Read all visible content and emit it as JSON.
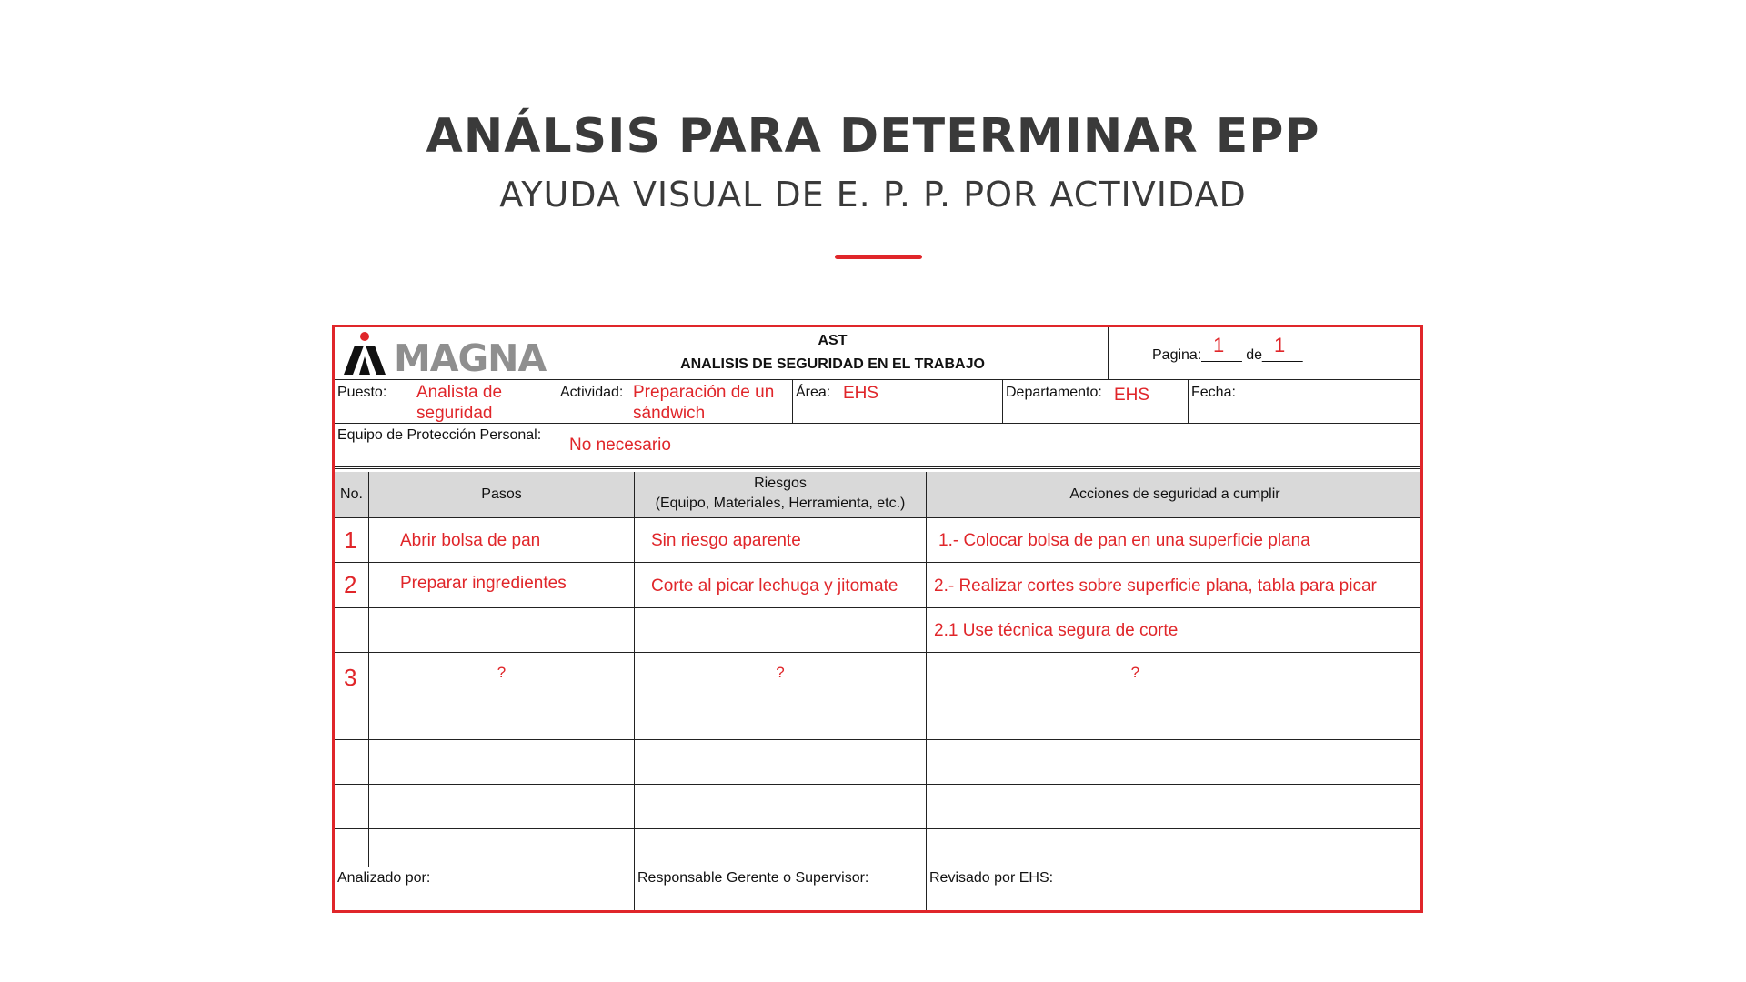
{
  "slide": {
    "title": "ANÁLSIS PARA DETERMINAR EPP",
    "subtitle": "AYUDA VISUAL DE E. P. P. POR ACTIVIDAD"
  },
  "form": {
    "logo_text": "MAGNA",
    "header_code": "AST",
    "header_title": "ANALISIS DE SEGURIDAD EN EL TRABAJO",
    "page_label": "Pagina:_____ de_____",
    "page_num": "1",
    "page_total": "1",
    "puesto_label": "Puesto:",
    "puesto_value": "Analista de seguridad",
    "actividad_label": "Actividad:",
    "actividad_value": "Preparación de un sándwich",
    "area_label": "Área:",
    "area_value": "EHS",
    "departamento_label": "Departamento:",
    "departamento_value": "EHS",
    "fecha_label": "Fecha:",
    "epp_label": "Equipo de Protección Personal:",
    "epp_value": "No necesario",
    "columns": {
      "no": "No.",
      "pasos": "Pasos",
      "riesgos_line1": "Riesgos",
      "riesgos_line2": "(Equipo, Materiales, Herramienta, etc.)",
      "acciones": "Acciones de seguridad a cumplir"
    },
    "rows": [
      {
        "no": "1",
        "paso": "Abrir bolsa de pan",
        "riesgo": "Sin riesgo aparente",
        "accion": "1.- Colocar bolsa de pan en una superficie plana"
      },
      {
        "no": "2",
        "paso": "Preparar ingredientes",
        "riesgo": "Corte al picar lechuga y jitomate",
        "accion": "2.- Realizar cortes sobre superficie plana, tabla para picar"
      },
      {
        "no": "",
        "paso": "",
        "riesgo": "",
        "accion": "2.1 Use técnica segura de corte"
      },
      {
        "no": "3",
        "paso": "?",
        "riesgo": "?",
        "accion": "?"
      }
    ],
    "footer": {
      "analizado": "Analizado por:",
      "responsable": "Responsable Gerente o Supervisor:",
      "revisado": "Revisado por EHS:"
    }
  }
}
